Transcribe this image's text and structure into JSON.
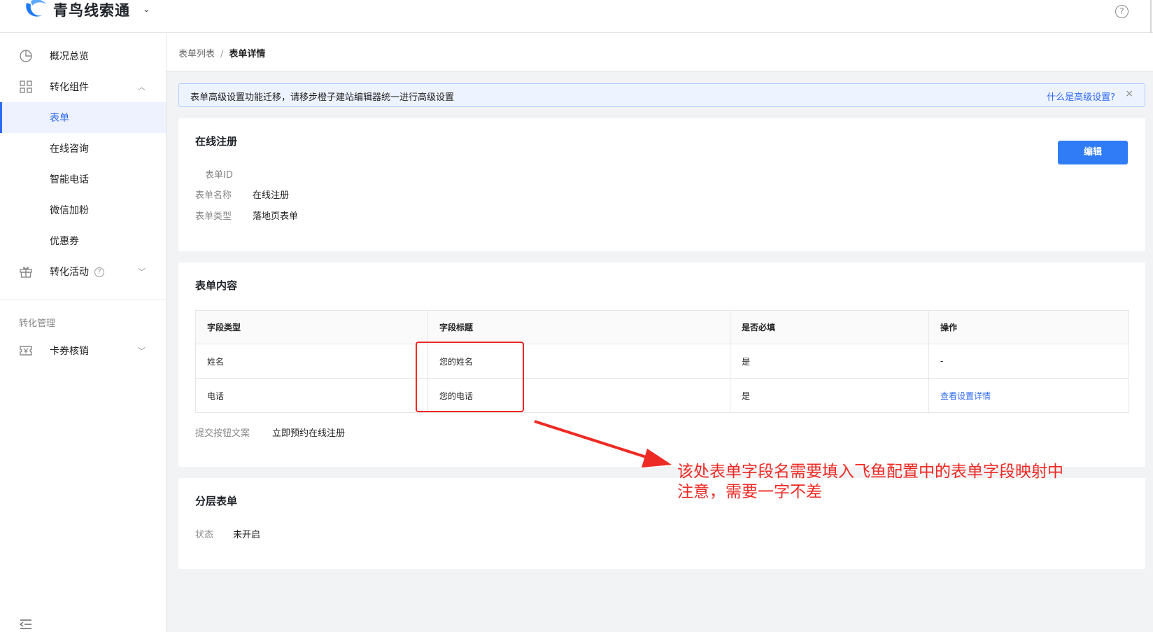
{
  "app": {
    "name": "青鸟线索通",
    "brand_color": "#2f6af6"
  },
  "sidebar": {
    "items": [
      {
        "label": "概况总览",
        "icon": "pie-chart-icon"
      },
      {
        "label": "转化组件",
        "icon": "grid-icon"
      },
      {
        "label": "表单",
        "active": true
      },
      {
        "label": "在线咨询"
      },
      {
        "label": "智能电话"
      },
      {
        "label": "微信加粉"
      },
      {
        "label": "优惠券"
      },
      {
        "label": "转化活动",
        "icon": "gift-icon"
      }
    ],
    "group_label": "转化管理",
    "group_items": [
      {
        "label": "卡券核销",
        "icon": "ticket-icon"
      }
    ]
  },
  "breadcrumb": {
    "parent": "表单列表",
    "separator": "/",
    "current": "表单详情"
  },
  "notice": {
    "text": "表单高级设置功能迁移，请移步橙子建站编辑器统一进行高级设置",
    "link": "什么是高级设置?",
    "close": "×"
  },
  "basic": {
    "title": "在线注册",
    "edit_label": "编辑",
    "fields": [
      {
        "key": "表单ID",
        "value": ""
      },
      {
        "key": "表单名称",
        "value": "在线注册"
      },
      {
        "key": "表单类型",
        "value": "落地页表单"
      }
    ]
  },
  "content": {
    "title": "表单内容",
    "columns": [
      "字段类型",
      "字段标题",
      "是否必填",
      "操作"
    ],
    "rows": [
      [
        "姓名",
        "您的姓名",
        "是",
        "-"
      ],
      [
        "电话",
        "您的电话",
        "是",
        "查看设置详情"
      ]
    ],
    "submit_key": "提交按钮文案",
    "submit_value": "立即预约在线注册"
  },
  "layered": {
    "title": "分层表单",
    "status_key": "状态",
    "status_value": "未开启"
  },
  "annotation": {
    "line1": "该处表单字段名需要填入飞鱼配置中的表单字段映射中",
    "line2": "注意，需要一字不差",
    "color": "#ee2a24"
  }
}
